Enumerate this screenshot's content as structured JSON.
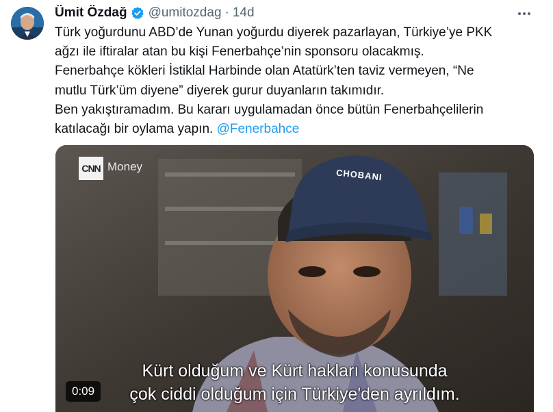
{
  "author": {
    "name": "Ümit Özdağ",
    "handle": "@umitozdag",
    "separator": "·",
    "time": "14d"
  },
  "tweet": {
    "text": "Türk yoğurdunu ABD’de  Yunan yoğurdu diyerek pazarlayan, Türkiye’ye PKK\nağzı ile iftiralar atan bu kişi Fenerbahçe’nin sponsoru olacakmış.\nFenerbahçe kökleri İstiklal Harbinde olan Atatürk’ten taviz vermeyen, “Ne\nmutlu Türk’üm diyene” diyerek gurur duyanların takımıdır.\nBen yakıştıramadım. Bu kararı uygulamadan önce bütün Fenerbahçelilerin\nkatılacağı bir oylama yapın. ",
    "mention": "@Fenerbahce"
  },
  "video": {
    "network_logo": "CNN",
    "network_label": "Money",
    "cap_text": "CHOBANI",
    "subtitle_line1": "Kürt olduğum ve Kürt hakları konusunda",
    "subtitle_line2": "çok ciddi olduğum için Türkiye'den ayrıldım.",
    "duration": "0:09"
  },
  "colors": {
    "link": "#1d9bf0",
    "verified": "#1d9bf0",
    "muted": "#536471"
  },
  "icons": [
    "verified-badge-icon",
    "more-options-icon"
  ]
}
